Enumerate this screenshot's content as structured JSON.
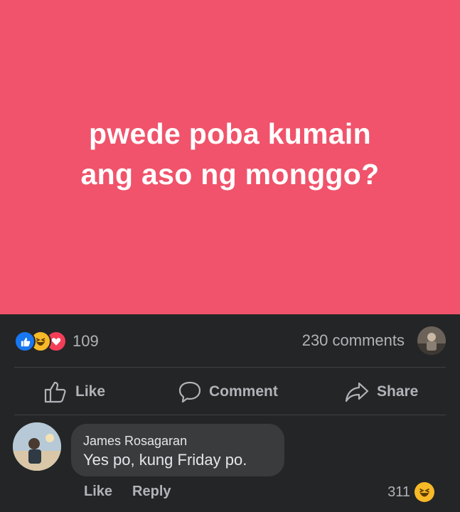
{
  "post": {
    "text_lines": [
      "pwede poba kumain",
      "ang aso ng monggo?"
    ],
    "background_color": "#f0536b"
  },
  "stats": {
    "reaction_icons": [
      "like-icon",
      "haha-icon",
      "love-icon"
    ],
    "reaction_count": "109",
    "comment_count": "230 comments"
  },
  "actions": {
    "like_label": "Like",
    "comment_label": "Comment",
    "share_label": "Share"
  },
  "comment": {
    "author": "James Rosagaran",
    "text": "Yes po, kung Friday po.",
    "like_label": "Like",
    "reply_label": "Reply",
    "reaction_count": "311",
    "reaction_icon": "haha-icon"
  },
  "colors": {
    "background": "#242526",
    "bubble": "#3a3b3c",
    "muted_text": "#b0b3b8",
    "like_blue": "#1877f2",
    "haha_yellow": "#f7b928",
    "love_red": "#f33e58"
  }
}
